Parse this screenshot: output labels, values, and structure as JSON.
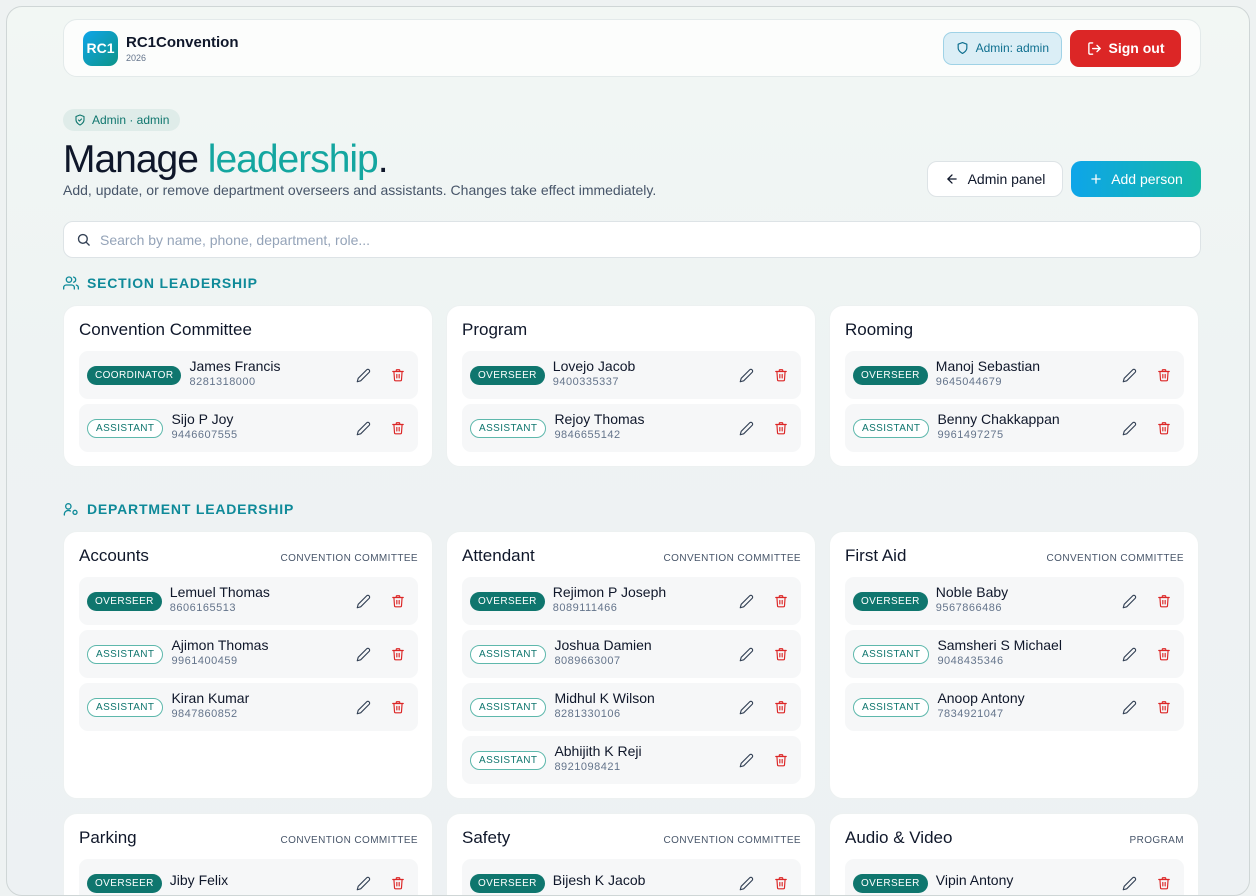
{
  "header": {
    "logo": "RC1",
    "brand_name": "RC1Convention",
    "brand_year": "2026",
    "admin_badge": "Admin: admin",
    "signout_label": "Sign out"
  },
  "page": {
    "crumb": "Admin · admin",
    "title_main": "Manage ",
    "title_accent": "leadership",
    "title_dot": ".",
    "subtitle": "Add, update, or remove department overseers and assistants. Changes take effect immediately.",
    "admin_panel_label": "Admin panel",
    "add_person_label": "Add person",
    "search_placeholder": "Search by name, phone, department, role..."
  },
  "sections": {
    "section_leadership": "SECTION LEADERSHIP",
    "department_leadership": "DEPARTMENT LEADERSHIP"
  },
  "section_cards": [
    {
      "title": "Convention Committee",
      "tag": "",
      "people": [
        {
          "role": "COORDINATOR",
          "style": "solid",
          "name": "James Francis",
          "phone": "8281318000"
        },
        {
          "role": "ASSISTANT",
          "style": "outline",
          "name": "Sijo P Joy",
          "phone": "9446607555"
        }
      ]
    },
    {
      "title": "Program",
      "tag": "",
      "people": [
        {
          "role": "OVERSEER",
          "style": "solid",
          "name": "Lovejo Jacob",
          "phone": "9400335337"
        },
        {
          "role": "ASSISTANT",
          "style": "outline",
          "name": "Rejoy Thomas",
          "phone": "9846655142"
        }
      ]
    },
    {
      "title": "Rooming",
      "tag": "",
      "people": [
        {
          "role": "OVERSEER",
          "style": "solid",
          "name": "Manoj Sebastian",
          "phone": "9645044679"
        },
        {
          "role": "ASSISTANT",
          "style": "outline",
          "name": "Benny Chakkappan",
          "phone": "9961497275"
        }
      ]
    }
  ],
  "department_cards": [
    {
      "title": "Accounts",
      "tag": "CONVENTION COMMITTEE",
      "people": [
        {
          "role": "OVERSEER",
          "style": "solid",
          "name": "Lemuel Thomas",
          "phone": "8606165513"
        },
        {
          "role": "ASSISTANT",
          "style": "outline",
          "name": "Ajimon Thomas",
          "phone": "9961400459"
        },
        {
          "role": "ASSISTANT",
          "style": "outline",
          "name": "Kiran Kumar",
          "phone": "9847860852"
        }
      ]
    },
    {
      "title": "Attendant",
      "tag": "CONVENTION COMMITTEE",
      "people": [
        {
          "role": "OVERSEER",
          "style": "solid",
          "name": "Rejimon P Joseph",
          "phone": "8089111466"
        },
        {
          "role": "ASSISTANT",
          "style": "outline",
          "name": "Joshua Damien",
          "phone": "8089663007"
        },
        {
          "role": "ASSISTANT",
          "style": "outline",
          "name": "Midhul K Wilson",
          "phone": "8281330106"
        },
        {
          "role": "ASSISTANT",
          "style": "outline",
          "name": "Abhijith K Reji",
          "phone": "8921098421"
        }
      ]
    },
    {
      "title": "First Aid",
      "tag": "CONVENTION COMMITTEE",
      "people": [
        {
          "role": "OVERSEER",
          "style": "solid",
          "name": "Noble Baby",
          "phone": "9567866486"
        },
        {
          "role": "ASSISTANT",
          "style": "outline",
          "name": "Samsheri S Michael",
          "phone": "9048435346"
        },
        {
          "role": "ASSISTANT",
          "style": "outline",
          "name": "Anoop Antony",
          "phone": "7834921047"
        }
      ]
    },
    {
      "title": "Parking",
      "tag": "CONVENTION COMMITTEE",
      "people": [
        {
          "role": "OVERSEER",
          "style": "solid",
          "name": "Jiby Felix",
          "phone": ""
        }
      ]
    },
    {
      "title": "Safety",
      "tag": "CONVENTION COMMITTEE",
      "people": [
        {
          "role": "OVERSEER",
          "style": "solid",
          "name": "Bijesh K Jacob",
          "phone": ""
        }
      ]
    },
    {
      "title": "Audio & Video",
      "tag": "PROGRAM",
      "people": [
        {
          "role": "OVERSEER",
          "style": "solid",
          "name": "Vipin Antony",
          "phone": ""
        }
      ]
    }
  ],
  "icons": {
    "shield": "shield-icon",
    "signout": "sign-out-icon",
    "arrow_left": "arrow-left-icon",
    "plus": "plus-icon",
    "search": "search-icon",
    "users": "users-icon",
    "user_cog": "user-cog-icon",
    "edit": "pencil-icon",
    "delete": "trash-icon"
  },
  "colors": {
    "accent": "#14a6a0",
    "danger": "#dc2626",
    "teal_dark": "#0f766e"
  }
}
